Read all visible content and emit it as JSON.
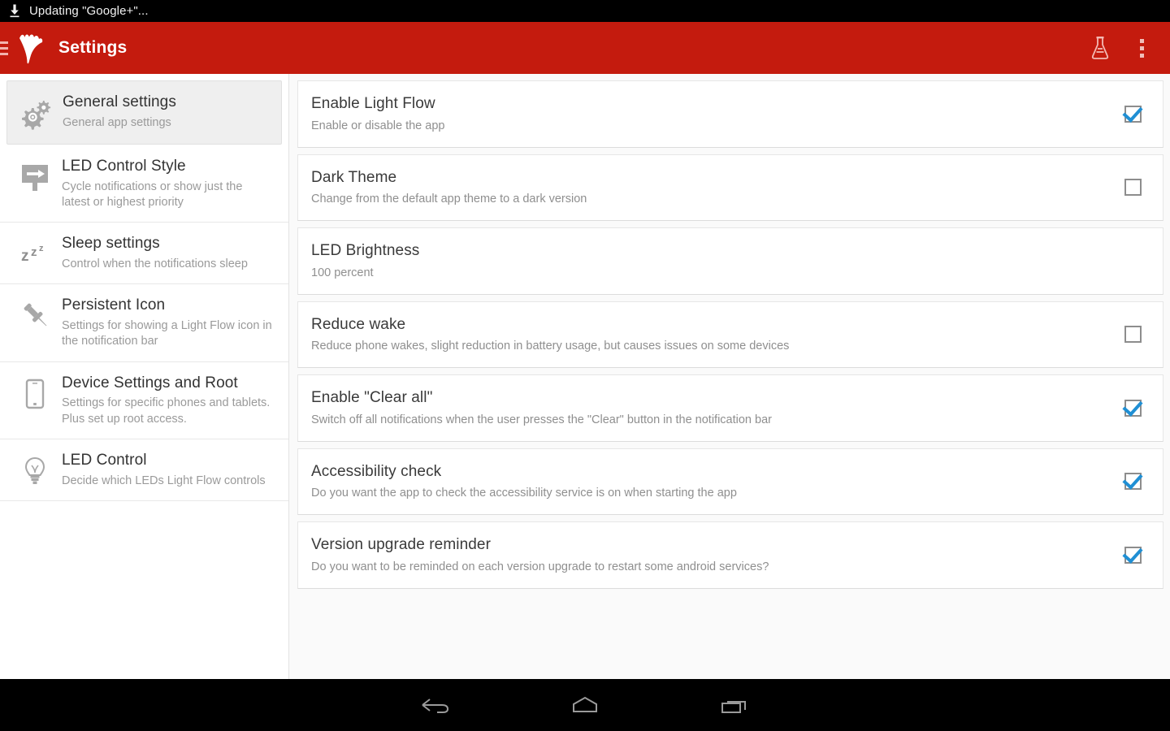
{
  "status_bar": {
    "icon": "download-icon",
    "text": "Updating \"Google+\"..."
  },
  "app_bar": {
    "title": "Settings",
    "menu_icon": "hamburger-icon",
    "logo_icon": "light-flow-logo",
    "actions": [
      {
        "icon": "flask-icon",
        "name": "test-button"
      },
      {
        "icon": "overflow-menu-icon",
        "name": "overflow-menu-button"
      }
    ],
    "accent_color": "#C41B0E"
  },
  "sidebar": {
    "items": [
      {
        "icon": "gears-icon",
        "title": "General settings",
        "subtitle": "General app settings",
        "selected": true
      },
      {
        "icon": "signpost-arrow-icon",
        "title": "LED Control Style",
        "subtitle": "Cycle notifications or show just the latest or highest priority",
        "selected": false
      },
      {
        "icon": "sleep-zzz-icon",
        "title": "Sleep settings",
        "subtitle": "Control when the notifications sleep",
        "selected": false
      },
      {
        "icon": "pushpin-icon",
        "title": "Persistent Icon",
        "subtitle": "Settings for showing a Light Flow icon in the notification bar",
        "selected": false
      },
      {
        "icon": "phone-icon",
        "title": "Device Settings and Root",
        "subtitle": "Settings for specific phones and tablets. Plus set up root access.",
        "selected": false
      },
      {
        "icon": "lightbulb-icon",
        "title": "LED Control",
        "subtitle": "Decide which LEDs Light Flow controls",
        "selected": false
      }
    ]
  },
  "main": {
    "checkbox_checked_color": "#1f8fd4",
    "preferences": [
      {
        "title": "Enable Light Flow",
        "subtitle": "Enable or disable the app",
        "control": "checkbox",
        "checked": true
      },
      {
        "title": "Dark Theme",
        "subtitle": "Change from the default app theme to a dark version",
        "control": "checkbox",
        "checked": false
      },
      {
        "title": "LED Brightness",
        "subtitle": "100 percent",
        "control": "none",
        "checked": false
      },
      {
        "title": "Reduce wake",
        "subtitle": "Reduce phone wakes, slight reduction in battery usage, but causes issues on some devices",
        "control": "checkbox",
        "checked": false
      },
      {
        "title": "Enable \"Clear all\"",
        "subtitle": "Switch off all notifications when the user presses the \"Clear\" button in the notification bar",
        "control": "checkbox",
        "checked": true
      },
      {
        "title": "Accessibility check",
        "subtitle": "Do you want the app to check the accessibility service is on when starting the app",
        "control": "checkbox",
        "checked": true
      },
      {
        "title": "Version upgrade reminder",
        "subtitle": "Do you want to be reminded on each version upgrade to restart some android services?",
        "control": "checkbox",
        "checked": true
      }
    ]
  },
  "nav_bar": {
    "buttons": [
      {
        "icon": "back-icon",
        "name": "back-button"
      },
      {
        "icon": "home-icon",
        "name": "home-button"
      },
      {
        "icon": "recents-icon",
        "name": "recents-button"
      }
    ]
  }
}
